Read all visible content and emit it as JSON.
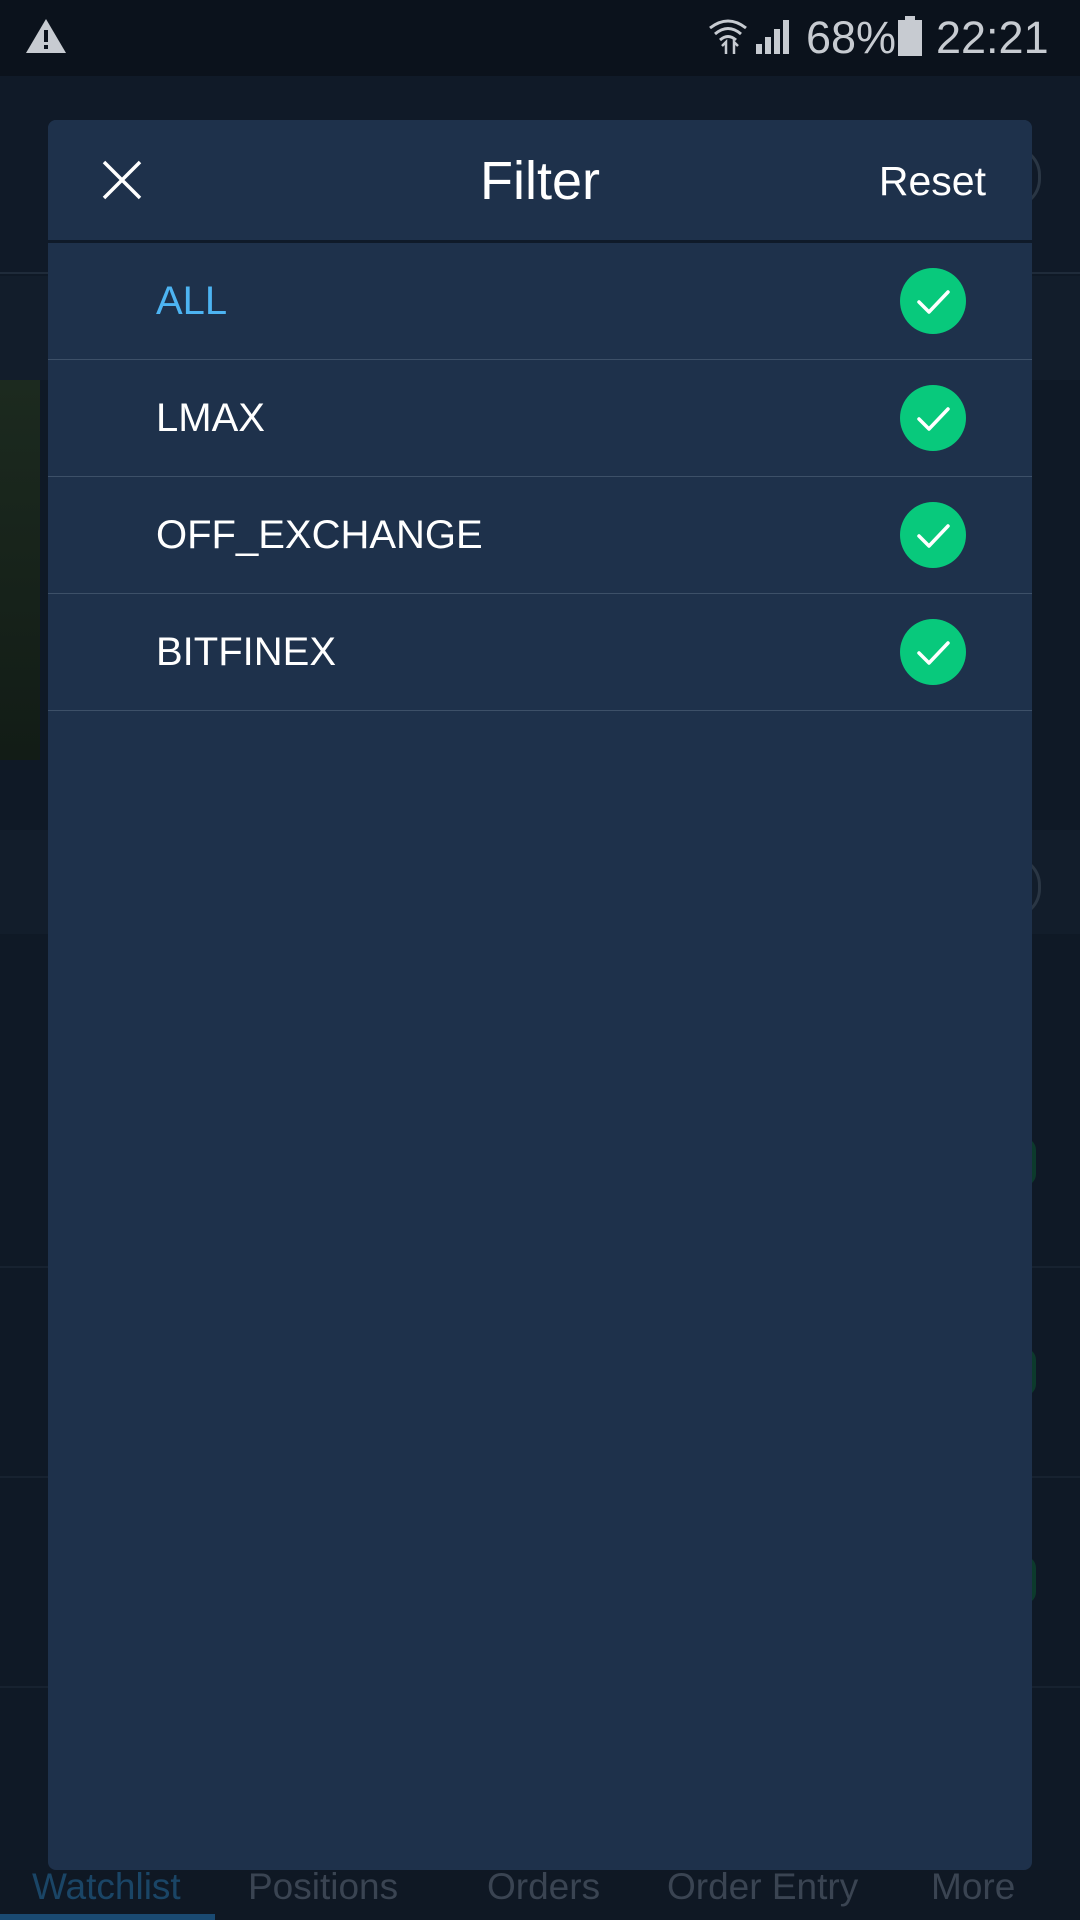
{
  "status_bar": {
    "battery_percent": "68%",
    "time": "22:21",
    "icons": [
      "warning-icon",
      "wifi-icon",
      "signal-icon",
      "battery-icon"
    ]
  },
  "background": {
    "tabs": [
      {
        "label": "Watchlist",
        "active": true
      },
      {
        "label": "Positions",
        "active": false
      },
      {
        "label": "Orders",
        "active": false
      },
      {
        "label": "Order Entry",
        "active": false
      },
      {
        "label": "More",
        "active": false
      }
    ]
  },
  "filter_modal": {
    "title": "Filter",
    "reset_label": "Reset",
    "close_icon": "close-icon",
    "items": [
      {
        "label": "ALL",
        "checked": true
      },
      {
        "label": "LMAX",
        "checked": true
      },
      {
        "label": "OFF_EXCHANGE",
        "checked": true
      },
      {
        "label": "BITFINEX",
        "checked": true
      }
    ]
  },
  "colors": {
    "accent": "#4db4f2",
    "check_green": "#08c97c",
    "modal_bg": "#1e314b"
  }
}
